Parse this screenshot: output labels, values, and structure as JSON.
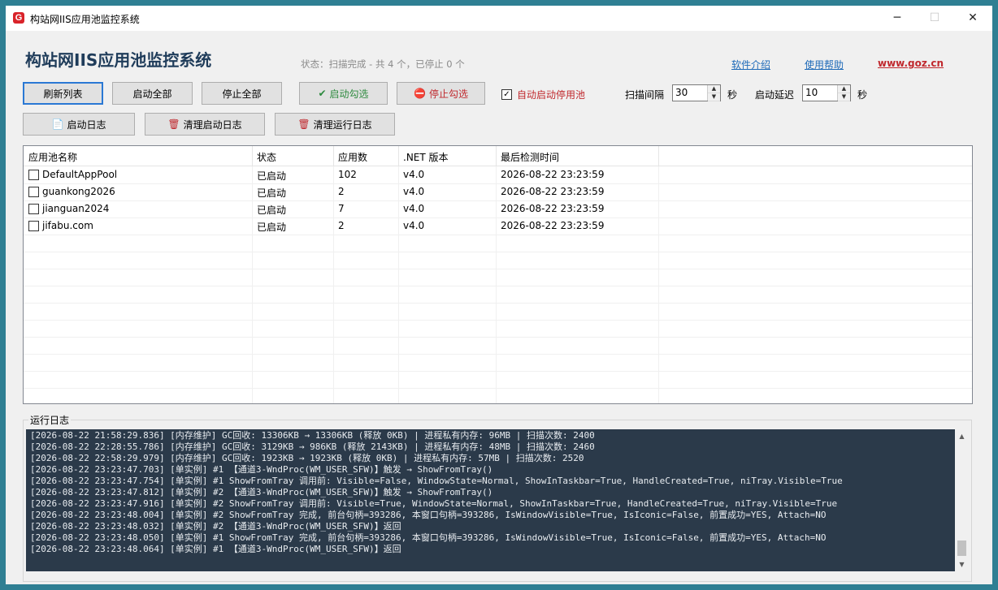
{
  "window": {
    "title": "构站网IIS应用池监控系统",
    "icon_letter": "G",
    "controls": {
      "minimize": "─",
      "maximize": "☐",
      "close": "✕"
    }
  },
  "header": {
    "heading": "构站网IIS应用池监控系统",
    "status": "状态：扫描完成 - 共 4 个，已停止 0 个",
    "links": {
      "intro": "软件介绍",
      "help": "使用帮助",
      "site": "www.goz.cn"
    }
  },
  "toolbar": {
    "refresh": "刷新列表",
    "start_all": "启动全部",
    "stop_all": "停止全部",
    "start_checked": "启动勾选",
    "stop_checked": "停止勾选",
    "auto_start_label": "自动启动停用池",
    "auto_start_checked": true,
    "scan_interval_label": "扫描间隔",
    "scan_interval_value": "30",
    "scan_interval_unit": "秒",
    "start_delay_label": "启动延迟",
    "start_delay_value": "10",
    "start_delay_unit": "秒",
    "start_log": "启动日志",
    "clear_start_log": "清理启动日志",
    "clear_run_log": "清理运行日志"
  },
  "table": {
    "columns": [
      "应用池名称",
      "状态",
      "应用数",
      ".NET 版本",
      "最后检测时间"
    ],
    "rows": [
      {
        "name": "DefaultAppPool",
        "status": "已启动",
        "apps": "102",
        "net": "v4.0",
        "time": "2026-08-22 23:23:59"
      },
      {
        "name": "guankong2026",
        "status": "已启动",
        "apps": "2",
        "net": "v4.0",
        "time": "2026-08-22 23:23:59"
      },
      {
        "name": "jianguan2024",
        "status": "已启动",
        "apps": "7",
        "net": "v4.0",
        "time": "2026-08-22 23:23:59"
      },
      {
        "name": "jifabu.com",
        "status": "已启动",
        "apps": "2",
        "net": "v4.0",
        "time": "2026-08-22 23:23:59"
      }
    ]
  },
  "log": {
    "title": "运行日志",
    "lines": [
      "[2026-08-22 21:58:29.836] [内存维护] GC回收: 13306KB → 13306KB (释放 0KB) | 进程私有内存: 96MB | 扫描次数: 2400",
      "[2026-08-22 22:28:55.786] [内存维护] GC回收: 3129KB → 986KB (释放 2143KB) | 进程私有内存: 48MB | 扫描次数: 2460",
      "[2026-08-22 22:58:29.979] [内存维护] GC回收: 1923KB → 1923KB (释放 0KB) | 进程私有内存: 57MB | 扫描次数: 2520",
      "[2026-08-22 23:23:47.703] [单实例] #1 【通道3-WndProc(WM_USER_SFW)】触发 → ShowFromTray()",
      "[2026-08-22 23:23:47.754] [单实例] #1 ShowFromTray 调用前: Visible=False, WindowState=Normal, ShowInTaskbar=True, HandleCreated=True, niTray.Visible=True",
      "[2026-08-22 23:23:47.812] [单实例] #2 【通道3-WndProc(WM_USER_SFW)】触发 → ShowFromTray()",
      "[2026-08-22 23:23:47.916] [单实例] #2 ShowFromTray 调用前: Visible=True, WindowState=Normal, ShowInTaskbar=True, HandleCreated=True, niTray.Visible=True",
      "[2026-08-22 23:23:48.004] [单实例] #2 ShowFromTray 完成, 前台句柄=393286, 本窗口句柄=393286, IsWindowVisible=True, IsIconic=False, 前置成功=YES, Attach=NO",
      "[2026-08-22 23:23:48.032] [单实例] #2 【通道3-WndProc(WM_USER_SFW)】返回",
      "[2026-08-22 23:23:48.050] [单实例] #1 ShowFromTray 完成, 前台句柄=393286, 本窗口句柄=393286, IsWindowVisible=True, IsIconic=False, 前置成功=YES, Attach=NO",
      "[2026-08-22 23:23:48.064] [单实例] #1 【通道3-WndProc(WM_USER_SFW)】返回"
    ]
  },
  "colors": {
    "desktop": "#2f7f93",
    "accent_blue": "#1e6ab8",
    "accent_red": "#c0282d",
    "accent_green": "#2d8a3e",
    "log_bg": "#2b3a4a"
  }
}
